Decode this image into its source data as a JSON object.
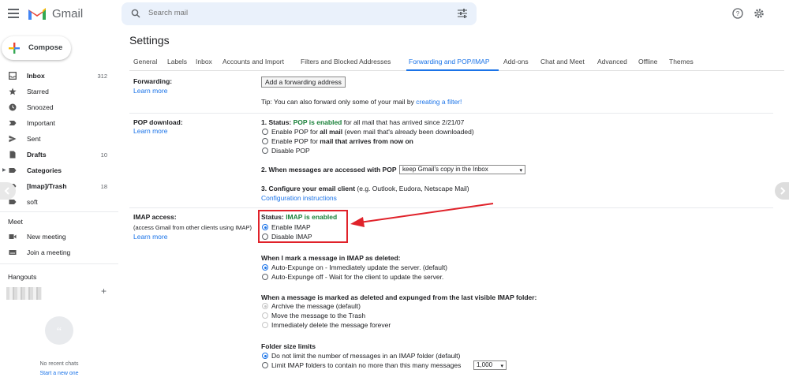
{
  "header": {
    "app_name": "Gmail",
    "search_placeholder": "Search mail"
  },
  "sidebar": {
    "compose_label": "Compose",
    "items": [
      {
        "label": "Inbox",
        "count": "312"
      },
      {
        "label": "Starred"
      },
      {
        "label": "Snoozed"
      },
      {
        "label": "Important"
      },
      {
        "label": "Sent"
      },
      {
        "label": "Drafts",
        "count": "10"
      },
      {
        "label": "Categories"
      },
      {
        "label": "[Imap]/Trash",
        "count": "18"
      },
      {
        "label": "soft"
      }
    ],
    "meet": {
      "title": "Meet",
      "new_meeting": "New meeting",
      "join_meeting": "Join a meeting"
    },
    "hangouts": {
      "title": "Hangouts",
      "no_chats": "No recent chats",
      "start_new": "Start a new one"
    }
  },
  "settings": {
    "title": "Settings",
    "tabs": [
      "General",
      "Labels",
      "Inbox",
      "Accounts and Import",
      "Filters and Blocked Addresses",
      "Forwarding and POP/IMAP",
      "Add-ons",
      "Chat and Meet",
      "Advanced",
      "Offline",
      "Themes"
    ],
    "active_tab": "Forwarding and POP/IMAP",
    "forwarding": {
      "label": "Forwarding:",
      "learn_more": "Learn more",
      "button": "Add a forwarding address",
      "tip_prefix": "Tip: You can also forward only some of your mail by",
      "tip_link": "creating a filter!"
    },
    "pop": {
      "label": "POP download:",
      "learn_more": "Learn more",
      "status_prefix": "1. Status:",
      "status_value": "POP is enabled",
      "status_suffix": "for all mail that has arrived since 2/21/07",
      "opt1_a": "Enable POP for",
      "opt1_b": "all mail",
      "opt1_c": "(even mail that's already been downloaded)",
      "opt2_a": "Enable POP for",
      "opt2_b": "mail that arrives from now on",
      "opt3": "Disable POP",
      "step2": "2. When messages are accessed with POP",
      "step2_select": "keep Gmail's copy in the Inbox",
      "step3_a": "3. Configure your email client",
      "step3_b": "(e.g. Outlook, Eudora, Netscape Mail)",
      "config_link": "Configuration instructions"
    },
    "imap": {
      "label": "IMAP access:",
      "sub": "(access Gmail from other clients using IMAP)",
      "learn_more": "Learn more",
      "status_prefix": "Status:",
      "status_value": "IMAP is enabled",
      "enable": "Enable IMAP",
      "disable": "Disable IMAP",
      "deleted_title": "When I mark a message in IMAP as deleted:",
      "auto_on": "Auto-Expunge on - Immediately update the server. (default)",
      "auto_off": "Auto-Expunge off - Wait for the client to update the server.",
      "expunged_title": "When a message is marked as deleted and expunged from the last visible IMAP folder:",
      "archive": "Archive the message (default)",
      "trash": "Move the message to the Trash",
      "delete_forever": "Immediately delete the message forever",
      "folder_title": "Folder size limits",
      "no_limit": "Do not limit the number of messages in an IMAP folder (default)",
      "limit": "Limit IMAP folders to contain no more than this many messages",
      "limit_select": "1,000"
    }
  },
  "colors": {
    "accent": "#1a73e8",
    "enabled_green": "#188038",
    "annotation_red": "#e0222a"
  }
}
